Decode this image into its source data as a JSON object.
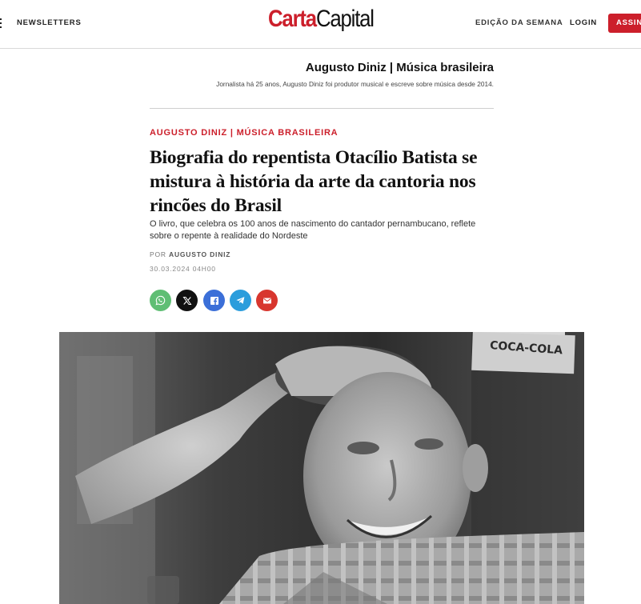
{
  "header": {
    "newsletters_label": "NEWSLETTERS",
    "logo_carta": "Carta",
    "logo_capital": "Capital",
    "edicao_label": "EDIÇÃO DA SEMANA",
    "login_label": "LOGIN",
    "assine_label": "ASSINE",
    "brand_color": "#cc1f2b"
  },
  "author_box": {
    "name": "Augusto Diniz | Música brasileira",
    "bio": "Jornalista há 25 anos, Augusto Diniz foi produtor musical e escreve sobre música desde 2014."
  },
  "article": {
    "kicker": "AUGUSTO DINIZ | MÚSICA BRASILEIRA",
    "headline": "Biografia do repentista Otacílio Batista se mistura à história da arte da cantoria nos rincões do Brasil",
    "subtitle": "O livro, que celebra os 100 anos de nascimento do cantador pernambucano, reflete sobre o repente à realidade do Nordeste",
    "byline_prefix": "POR",
    "byline_author": "AUGUSTO DINIZ",
    "date": "30.03.2024 04H00"
  },
  "share_buttons": [
    {
      "icon": "whatsapp-icon",
      "color": "#5fbe74"
    },
    {
      "icon": "x-icon",
      "color": "#111111"
    },
    {
      "icon": "facebook-icon",
      "color": "#3b6fd8"
    },
    {
      "icon": "telegram-icon",
      "color": "#2b9ddc"
    },
    {
      "icon": "email-icon",
      "color": "#d8362e"
    }
  ],
  "photo": {
    "sign_text": "COCA-COLA",
    "style": "black-and-white portrait"
  }
}
